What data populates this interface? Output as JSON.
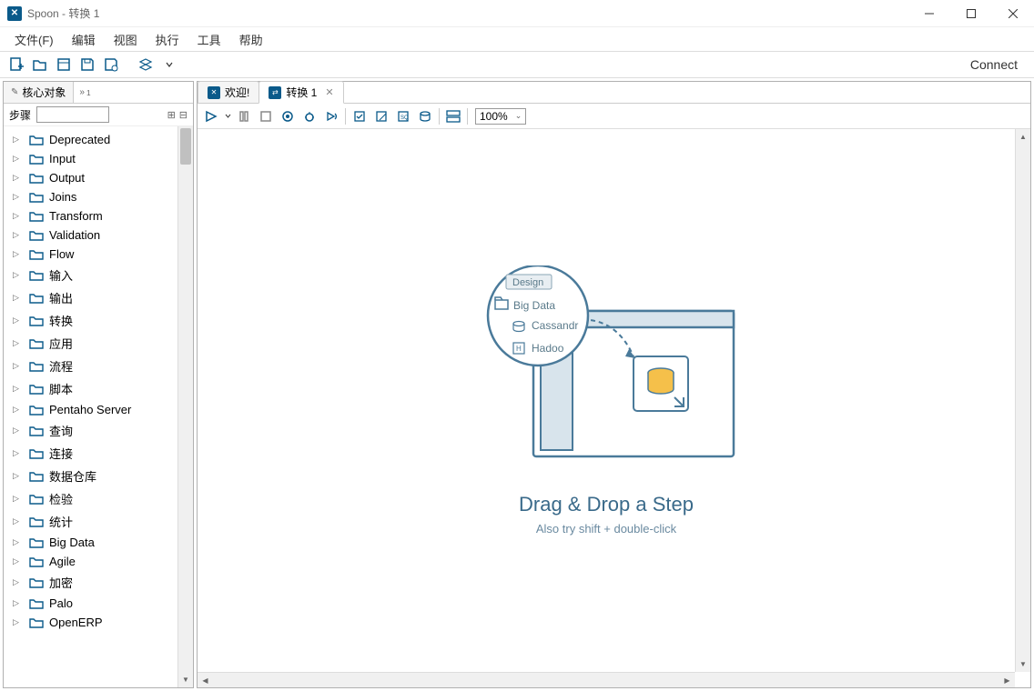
{
  "window": {
    "title": "Spoon - 转换 1"
  },
  "menu": {
    "file": "文件(F)",
    "edit": "编辑",
    "view": "视图",
    "run": "执行",
    "tools": "工具",
    "help": "帮助"
  },
  "toolbar": {
    "connect": "Connect"
  },
  "sidebar": {
    "tab": "核心对象",
    "overflow": "1",
    "filter_label": "步骤",
    "items": [
      {
        "label": "Deprecated"
      },
      {
        "label": "Input"
      },
      {
        "label": "Output"
      },
      {
        "label": "Joins"
      },
      {
        "label": "Transform"
      },
      {
        "label": "Validation"
      },
      {
        "label": "Flow"
      },
      {
        "label": "输入"
      },
      {
        "label": "输出"
      },
      {
        "label": "转换"
      },
      {
        "label": "应用"
      },
      {
        "label": "流程"
      },
      {
        "label": "脚本"
      },
      {
        "label": "Pentaho Server"
      },
      {
        "label": "查询"
      },
      {
        "label": "连接"
      },
      {
        "label": "数据仓库"
      },
      {
        "label": "检验"
      },
      {
        "label": "统计"
      },
      {
        "label": "Big Data"
      },
      {
        "label": "Agile"
      },
      {
        "label": "加密"
      },
      {
        "label": "Palo"
      },
      {
        "label": "OpenERP"
      }
    ]
  },
  "tabs": {
    "welcome": "欢迎!",
    "trans": "转换 1"
  },
  "canvas": {
    "zoom": "100%",
    "placeholder": {
      "design_tab": "Design",
      "folder": "Big Data",
      "item1": "Cassandr",
      "item2": "Hadoo",
      "title": "Drag & Drop a Step",
      "sub": "Also try shift + double-click"
    }
  }
}
